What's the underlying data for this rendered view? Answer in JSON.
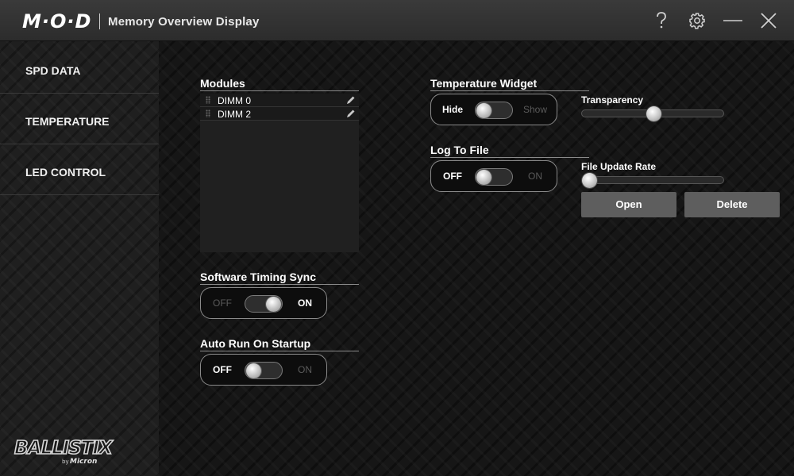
{
  "app": {
    "logo_text": "M·O·D",
    "title": "Memory Overview Display",
    "icons": [
      "help-icon",
      "gear-icon",
      "minimize-icon",
      "close-icon"
    ]
  },
  "sidebar": {
    "items": [
      {
        "label": "SPD DATA"
      },
      {
        "label": "TEMPERATURE"
      },
      {
        "label": "LED CONTROL"
      }
    ],
    "brand": {
      "name": "BALLISTIX",
      "byline": "by Micron"
    }
  },
  "modules": {
    "title": "Modules",
    "items": [
      {
        "label": "DIMM 0"
      },
      {
        "label": "DIMM 2"
      }
    ]
  },
  "software_timing_sync": {
    "title": "Software Timing Sync",
    "off_label": "OFF",
    "on_label": "ON",
    "state": "on"
  },
  "auto_run": {
    "title": "Auto Run On Startup",
    "off_label": "OFF",
    "on_label": "ON",
    "state": "off"
  },
  "temperature_widget": {
    "title": "Temperature Widget",
    "off_label": "Hide",
    "on_label": "Show",
    "state": "off"
  },
  "transparency": {
    "label": "Transparency",
    "value_fraction": 0.5
  },
  "log_to_file": {
    "title": "Log To File",
    "off_label": "OFF",
    "on_label": "ON",
    "state": "off"
  },
  "file_update_rate": {
    "label": "File Update Rate",
    "value_fraction": 0.0
  },
  "buttons": {
    "open": "Open",
    "delete": "Delete"
  },
  "colors": {
    "accent": "#ffffff",
    "background": "#161616",
    "button": "#5e5e5e"
  }
}
